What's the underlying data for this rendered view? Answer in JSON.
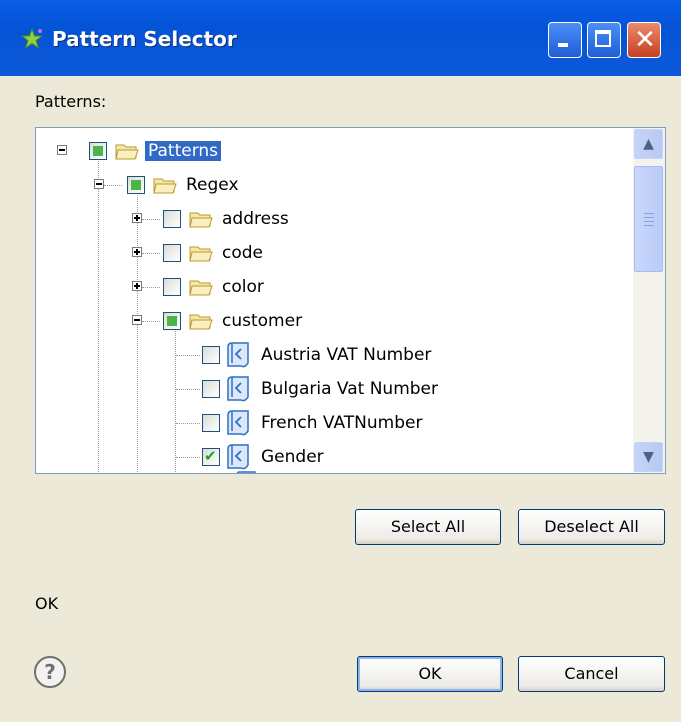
{
  "window": {
    "title": "Pattern Selector",
    "title_icon": "sparkle-star-icon"
  },
  "patterns_label": "Patterns:",
  "tree": {
    "root": {
      "label": "Patterns",
      "state": "partial",
      "selected": true
    },
    "regex": {
      "label": "Regex",
      "state": "partial"
    },
    "folders": [
      {
        "label": "address",
        "state": "unchecked",
        "expanded": false
      },
      {
        "label": "code",
        "state": "unchecked",
        "expanded": false
      },
      {
        "label": "color",
        "state": "unchecked",
        "expanded": false
      },
      {
        "label": "customer",
        "state": "partial",
        "expanded": true
      }
    ],
    "patterns": [
      {
        "label": "Austria VAT Number",
        "checked": false
      },
      {
        "label": "Bulgaria Vat Number",
        "checked": false
      },
      {
        "label": "French VATNumber",
        "checked": false
      },
      {
        "label": "Gender",
        "checked": true
      }
    ]
  },
  "buttons": {
    "select_all": "Select All",
    "deselect_all": "Deselect All",
    "ok": "OK",
    "cancel": "Cancel"
  },
  "status_text": "OK",
  "colors": {
    "titlebar": "#0453d6",
    "selection": "#316ac5",
    "partial_fill": "#4cb54a",
    "close_button": "#c8401f"
  }
}
